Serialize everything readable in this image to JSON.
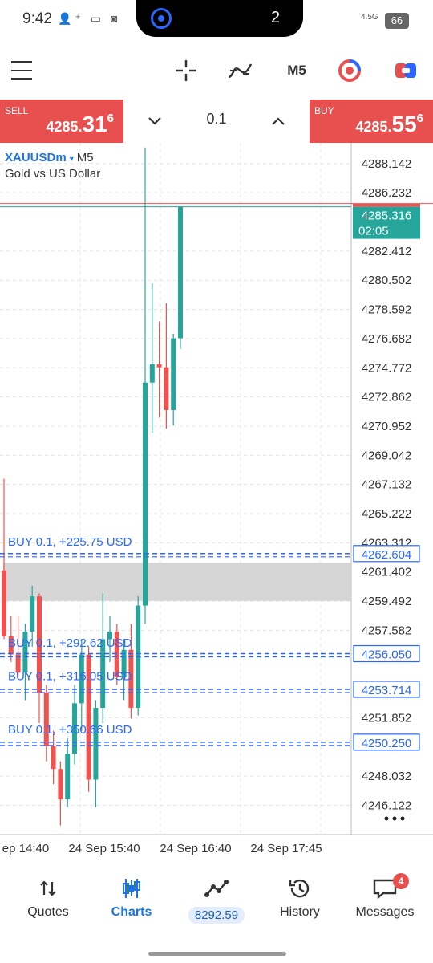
{
  "status_bar": {
    "time": "9:42",
    "notch_count": "2",
    "network": "4.5G",
    "battery": "66"
  },
  "toolbar": {
    "timeframe": "M5"
  },
  "trade_bar": {
    "sell_label": "SELL",
    "sell_price_main": "4285.",
    "sell_price_big": "31",
    "sell_price_sup": "6",
    "buy_label": "BUY",
    "buy_price_main": "4285.",
    "buy_price_big": "55",
    "buy_price_sup": "6",
    "volume": "0.1"
  },
  "chart_header": {
    "symbol": "XAUUSDm",
    "arrow": "▾",
    "timeframe": "M5",
    "description": "Gold vs US Dollar"
  },
  "chart_data": {
    "type": "candlestick",
    "y_range": [
      4244.2,
      4289.5
    ],
    "y_ticks": [
      "4288.142",
      "4286.232",
      "4282.412",
      "4280.502",
      "4278.592",
      "4276.682",
      "4274.772",
      "4272.862",
      "4270.952",
      "4269.042",
      "4267.132",
      "4265.222",
      "4263.312",
      "4261.402",
      "4259.492",
      "4257.582",
      "4251.852",
      "4248.032",
      "4246.122"
    ],
    "x_labels": [
      "ep 14:40",
      "24 Sep 15:40",
      "24 Sep 16:40",
      "24 Sep 17:45"
    ],
    "current_price": {
      "value": "4285.316",
      "countdown": "02:05"
    },
    "price_tags": [
      "4262.604",
      "4256.050",
      "4253.714",
      "4250.250"
    ],
    "position_labels": [
      "BUY 0.1,  +225.75 USD",
      "BUY 0.1,  +292.62 USD",
      "BUY 0.1,  +316.05 USD",
      "BUY 0.1,  +350.66 USD"
    ],
    "zone": {
      "from": 4259.5,
      "to": 4262.0
    },
    "candles": [
      {
        "o": 4261.5,
        "h": 4267.5,
        "l": 4257.0,
        "c": 4257.2
      },
      {
        "o": 4257.2,
        "h": 4258.5,
        "l": 4255.5,
        "c": 4256.0
      },
      {
        "o": 4256.0,
        "h": 4258.5,
        "l": 4254.5,
        "c": 4254.8
      },
      {
        "o": 4254.8,
        "h": 4258.0,
        "l": 4253.0,
        "c": 4257.5
      },
      {
        "o": 4257.5,
        "h": 4260.5,
        "l": 4256.5,
        "c": 4259.8
      },
      {
        "o": 4259.8,
        "h": 4260.0,
        "l": 4251.5,
        "c": 4253.5
      },
      {
        "o": 4253.5,
        "h": 4254.0,
        "l": 4249.0,
        "c": 4250.0
      },
      {
        "o": 4250.0,
        "h": 4251.0,
        "l": 4247.5,
        "c": 4248.5
      },
      {
        "o": 4248.5,
        "h": 4249.0,
        "l": 4244.8,
        "c": 4246.5
      },
      {
        "o": 4246.5,
        "h": 4250.5,
        "l": 4246.0,
        "c": 4249.5
      },
      {
        "o": 4249.5,
        "h": 4254.0,
        "l": 4248.8,
        "c": 4252.8
      },
      {
        "o": 4252.8,
        "h": 4257.0,
        "l": 4251.0,
        "c": 4256.0
      },
      {
        "o": 4256.0,
        "h": 4256.5,
        "l": 4247.0,
        "c": 4247.8
      },
      {
        "o": 4247.8,
        "h": 4253.0,
        "l": 4246.0,
        "c": 4252.5
      },
      {
        "o": 4252.5,
        "h": 4260.0,
        "l": 4251.5,
        "c": 4257.0
      },
      {
        "o": 4257.0,
        "h": 4258.5,
        "l": 4255.5,
        "c": 4257.5
      },
      {
        "o": 4257.5,
        "h": 4258.0,
        "l": 4254.0,
        "c": 4254.5
      },
      {
        "o": 4254.5,
        "h": 4257.0,
        "l": 4253.0,
        "c": 4256.3
      },
      {
        "o": 4256.3,
        "h": 4258.0,
        "l": 4251.8,
        "c": 4252.5
      },
      {
        "o": 4252.5,
        "h": 4259.8,
        "l": 4252.0,
        "c": 4259.2
      },
      {
        "o": 4259.2,
        "h": 4289.2,
        "l": 4258.0,
        "c": 4273.8
      },
      {
        "o": 4273.8,
        "h": 4280.3,
        "l": 4270.5,
        "c": 4275.0
      },
      {
        "o": 4275.0,
        "h": 4277.8,
        "l": 4271.5,
        "c": 4274.8
      },
      {
        "o": 4274.8,
        "h": 4279.0,
        "l": 4270.8,
        "c": 4272.0
      },
      {
        "o": 4272.0,
        "h": 4277.0,
        "l": 4271.0,
        "c": 4276.7
      },
      {
        "o": 4276.7,
        "h": 4285.3,
        "l": 4276.0,
        "c": 4285.3
      }
    ]
  },
  "bottom_nav": {
    "quotes": "Quotes",
    "charts": "Charts",
    "balance": "8292.59",
    "history": "History",
    "messages": "Messages",
    "messages_badge": "4"
  }
}
